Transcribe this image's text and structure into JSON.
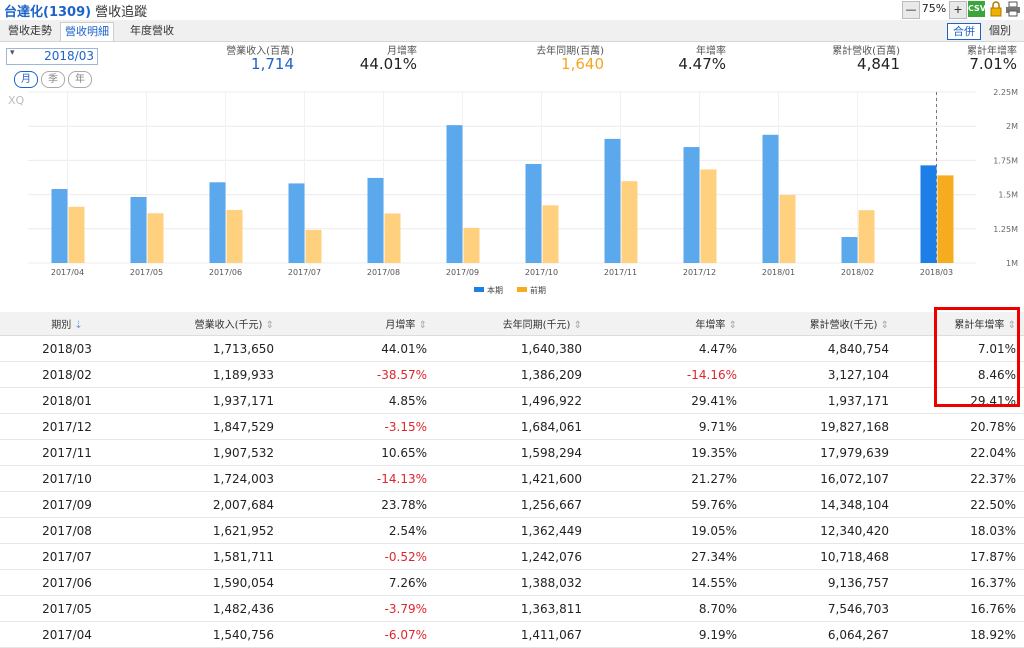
{
  "header": {
    "company": "台達化(1309)",
    "page_title": "營收追蹤",
    "zoom": "75%",
    "csv": "CSV"
  },
  "tabs": [
    {
      "label": "營收走勢"
    },
    {
      "label": "營收明細"
    },
    {
      "label": "年度營收"
    }
  ],
  "view_toggle": {
    "merged": "合併",
    "individual": "個別"
  },
  "period_selector": {
    "value": "2018/03",
    "buttons": [
      "月",
      "季",
      "年"
    ]
  },
  "summary": {
    "revenue_label": "營業收入(百萬)",
    "revenue_value": "1,714",
    "mom_label": "月增率",
    "mom_value": "44.01%",
    "ly_label": "去年同期(百萬)",
    "ly_value": "1,640",
    "yoy_label": "年增率",
    "yoy_value": "4.47%",
    "cum_label": "累計營收(百萬)",
    "cum_value": "4,841",
    "cum_yoy_label": "累計年增率",
    "cum_yoy_value": "7.01%"
  },
  "chart_data": {
    "type": "bar",
    "watermark": "XQ",
    "categories": [
      "2017/04",
      "2017/05",
      "2017/06",
      "2017/07",
      "2017/08",
      "2017/09",
      "2017/10",
      "2017/11",
      "2017/12",
      "2018/01",
      "2018/02",
      "2018/03"
    ],
    "series": [
      {
        "name": "本期",
        "color": "#5ba8ed",
        "highlight_color": "#1d7ee8",
        "values": [
          1540756,
          1482436,
          1590054,
          1581711,
          1621952,
          2007684,
          1724003,
          1907532,
          1847529,
          1937171,
          1189933,
          1713650
        ]
      },
      {
        "name": "前期",
        "color": "#ffd17f",
        "highlight_color": "#f5ac1e",
        "values": [
          1411067,
          1363811,
          1388032,
          1242076,
          1362449,
          1256667,
          1421600,
          1598294,
          1684061,
          1496922,
          1386209,
          1640380
        ]
      }
    ],
    "ylim": [
      1000000,
      2250000
    ],
    "yticks": [
      "1M",
      "1.25M",
      "1.5M",
      "1.75M",
      "2M",
      "2.25M"
    ],
    "legend": "bottom-center"
  },
  "table": {
    "columns": [
      "期別",
      "營業收入(千元)",
      "月增率",
      "去年同期(千元)",
      "年增率",
      "累計營收(千元)",
      "累計年增率"
    ],
    "rows": [
      [
        "2018/03",
        "1,713,650",
        "44.01%",
        "1,640,380",
        "4.47%",
        "4,840,754",
        "7.01%"
      ],
      [
        "2018/02",
        "1,189,933",
        "-38.57%",
        "1,386,209",
        "-14.16%",
        "3,127,104",
        "8.46%"
      ],
      [
        "2018/01",
        "1,937,171",
        "4.85%",
        "1,496,922",
        "29.41%",
        "1,937,171",
        "29.41%"
      ],
      [
        "2017/12",
        "1,847,529",
        "-3.15%",
        "1,684,061",
        "9.71%",
        "19,827,168",
        "20.78%"
      ],
      [
        "2017/11",
        "1,907,532",
        "10.65%",
        "1,598,294",
        "19.35%",
        "17,979,639",
        "22.04%"
      ],
      [
        "2017/10",
        "1,724,003",
        "-14.13%",
        "1,421,600",
        "21.27%",
        "16,072,107",
        "22.37%"
      ],
      [
        "2017/09",
        "2,007,684",
        "23.78%",
        "1,256,667",
        "59.76%",
        "14,348,104",
        "22.50%"
      ],
      [
        "2017/08",
        "1,621,952",
        "2.54%",
        "1,362,449",
        "19.05%",
        "12,340,420",
        "18.03%"
      ],
      [
        "2017/07",
        "1,581,711",
        "-0.52%",
        "1,242,076",
        "27.34%",
        "10,718,468",
        "17.87%"
      ],
      [
        "2017/06",
        "1,590,054",
        "7.26%",
        "1,388,032",
        "14.55%",
        "9,136,757",
        "16.37%"
      ],
      [
        "2017/05",
        "1,482,436",
        "-3.79%",
        "1,363,811",
        "8.70%",
        "7,546,703",
        "16.76%"
      ],
      [
        "2017/04",
        "1,540,756",
        "-6.07%",
        "1,411,067",
        "9.19%",
        "6,064,267",
        "18.92%"
      ]
    ]
  },
  "annotation": {
    "color": "#e00000"
  }
}
